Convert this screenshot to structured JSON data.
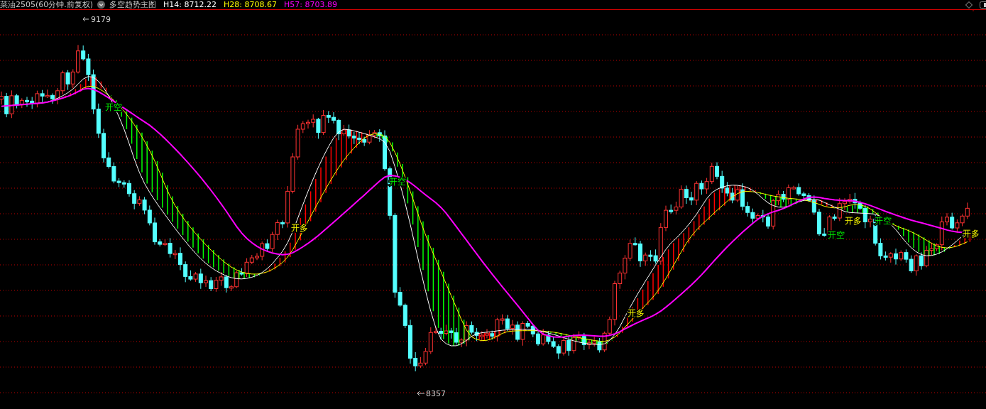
{
  "header": {
    "title": "菜油2505(60分钟.前复权)",
    "indicator_name": "多空趋势主图",
    "indicators": [
      {
        "label": "H14: 8712.22",
        "color": "#ffffff"
      },
      {
        "label": "H28: 8708.67",
        "color": "#ffff00"
      },
      {
        "label": "H57: 8703.89",
        "color": "#ff00ff"
      }
    ]
  },
  "chart": {
    "high_label": "9179",
    "low_label": "8357",
    "signals": [
      {
        "text": "开空",
        "kind": "short"
      },
      {
        "text": "开多",
        "kind": "long"
      },
      {
        "text": "开空",
        "kind": "short"
      },
      {
        "text": "开多",
        "kind": "long"
      },
      {
        "text": "开空",
        "kind": "short"
      },
      {
        "text": "开多",
        "kind": "long"
      },
      {
        "text": "开空",
        "kind": "short"
      },
      {
        "text": "开多",
        "kind": "long"
      }
    ]
  }
}
